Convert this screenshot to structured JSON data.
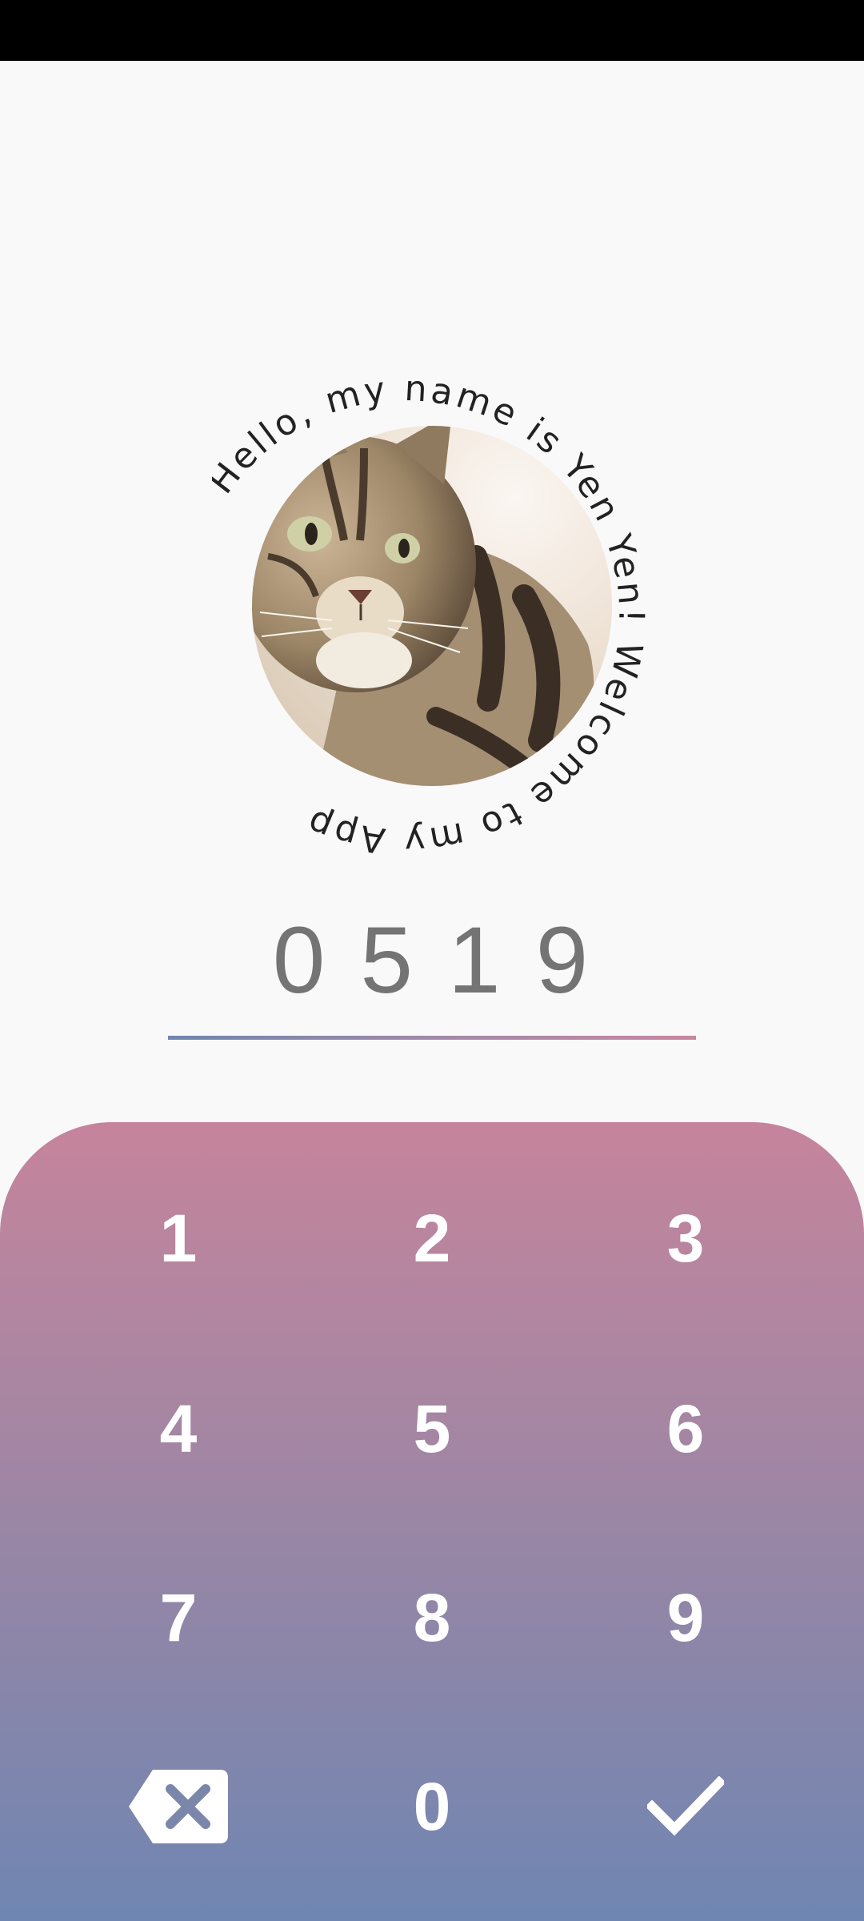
{
  "greeting": "Hello, my name is Yen Yen! Welcome to my App.",
  "pin": {
    "value": "0519"
  },
  "keypad": {
    "keys": [
      "1",
      "2",
      "3",
      "4",
      "5",
      "6",
      "7",
      "8",
      "9",
      "0"
    ],
    "backspace_icon": "backspace-icon",
    "confirm_icon": "check-icon"
  },
  "colors": {
    "keypad_top": "#c6849c",
    "keypad_bottom": "#6f86b2",
    "pin_text": "#747474"
  }
}
